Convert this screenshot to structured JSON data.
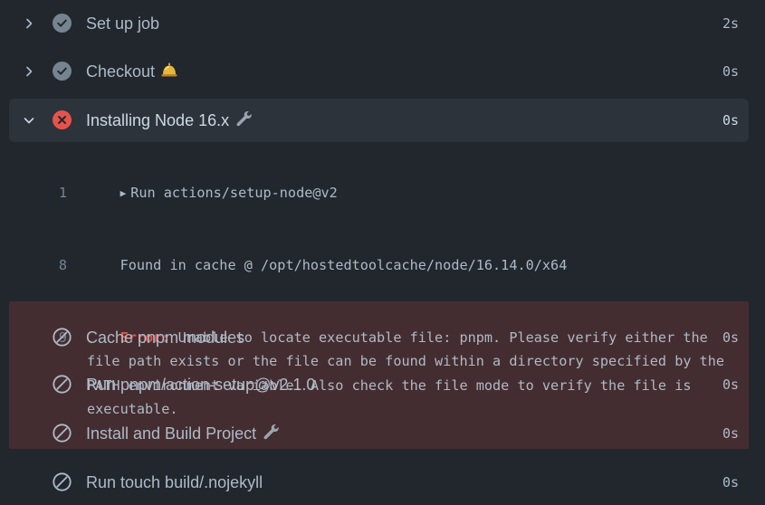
{
  "steps_before": [
    {
      "label": "Set up job",
      "emoji": "",
      "duration": "2s",
      "status": "success"
    },
    {
      "label": "Checkout",
      "emoji": "bell-emoji",
      "duration": "0s",
      "status": "success"
    }
  ],
  "active_step": {
    "label": "Installing Node 16.x",
    "emoji": "wrench-emoji",
    "duration": "0s",
    "status": "failure"
  },
  "log": {
    "lines": [
      {
        "number": "1",
        "text": "Run actions/setup-node@v2",
        "collapsible": true
      },
      {
        "number": "8",
        "text": "Found in cache @ /opt/hostedtoolcache/node/16.14.0/x64"
      }
    ],
    "error_line": {
      "number": "9",
      "prefix": "Error:",
      "text": " Unable to locate executable file: pnpm. Please verify either the file path exists or the file can be found within a directory specified by the PATH environment variable. Also check the file mode to verify the file is executable."
    }
  },
  "steps_after": [
    {
      "label": "Cache pnpm modules",
      "emoji": "",
      "duration": "0s",
      "status": "skipped"
    },
    {
      "label": "Run pnpm/action-setup@v2.1.0",
      "emoji": "",
      "duration": "0s",
      "status": "skipped"
    },
    {
      "label": "Install and Build Project",
      "emoji": "wrench-emoji",
      "duration": "0s",
      "status": "skipped"
    },
    {
      "label": "Run touch build/.nojekyll",
      "emoji": "",
      "duration": "0s",
      "status": "skipped"
    }
  ],
  "colors": {
    "background": "#22272e",
    "expanded_row": "#2d333b",
    "success_icon": "#768390",
    "failure_icon": "#e5534b",
    "error_bg": "#442d30",
    "error_text": "#e5534b"
  }
}
